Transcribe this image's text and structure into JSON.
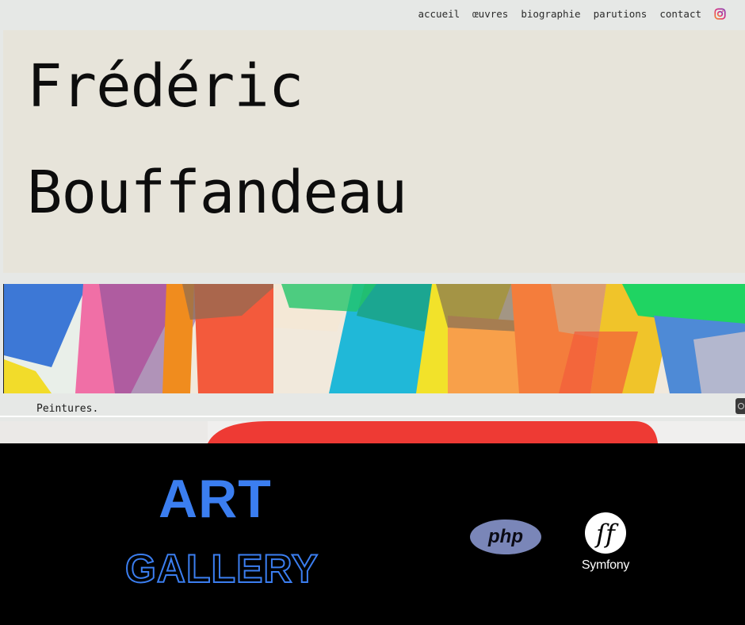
{
  "nav": {
    "items": [
      "accueil",
      "œuvres",
      "biographie",
      "parutions",
      "contact"
    ],
    "instagram_icon": "instagram-icon"
  },
  "hero": {
    "first_name": "Frédéric",
    "last_name": "Bouffandeau"
  },
  "gallery": {
    "caption": "Peintures."
  },
  "banner": {
    "title_line1": "ART",
    "title_line2": "GALLERY",
    "php_label": "php",
    "symfony_label": "Symfony",
    "accent_color": "#3b7ef0"
  }
}
